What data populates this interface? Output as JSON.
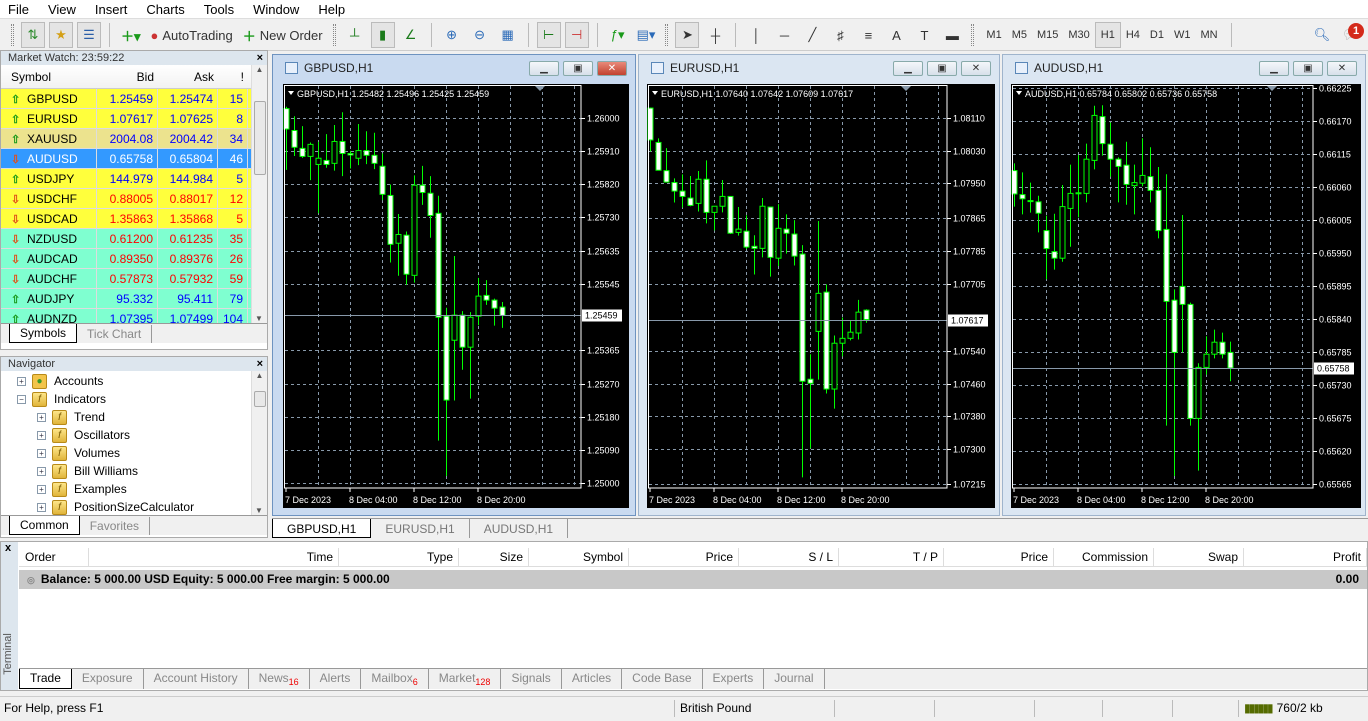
{
  "menu": [
    "File",
    "View",
    "Insert",
    "Charts",
    "Tools",
    "Window",
    "Help"
  ],
  "toolbar": {
    "autotrading": "AutoTrading",
    "new_order": "New Order",
    "timeframes": [
      "M1",
      "M5",
      "M15",
      "M30",
      "H1",
      "H4",
      "D1",
      "W1",
      "MN"
    ],
    "active_timeframe": "H1",
    "notification_count": "1"
  },
  "market_watch": {
    "title": "Market Watch: 23:59:22",
    "columns": [
      "Symbol",
      "Bid",
      "Ask",
      "!"
    ],
    "rows": [
      {
        "symbol": "GBPUSD",
        "bid": "1.25459",
        "ask": "1.25474",
        "spread": "15",
        "dir": "up",
        "bg": "#ffff3c"
      },
      {
        "symbol": "EURUSD",
        "bid": "1.07617",
        "ask": "1.07625",
        "spread": "8",
        "dir": "up",
        "bg": "#ffff3c"
      },
      {
        "symbol": "XAUUSD",
        "bid": "2004.08",
        "ask": "2004.42",
        "spread": "34",
        "dir": "up",
        "bg": "#ece38e"
      },
      {
        "symbol": "AUDUSD",
        "bid": "0.65758",
        "ask": "0.65804",
        "spread": "46",
        "dir": "down",
        "bg": "#3399ff",
        "selected": true
      },
      {
        "symbol": "USDJPY",
        "bid": "144.979",
        "ask": "144.984",
        "spread": "5",
        "dir": "up",
        "bg": "#ffff3c"
      },
      {
        "symbol": "USDCHF",
        "bid": "0.88005",
        "ask": "0.88017",
        "spread": "12",
        "dir": "down",
        "bg": "#ffff3c"
      },
      {
        "symbol": "USDCAD",
        "bid": "1.35863",
        "ask": "1.35868",
        "spread": "5",
        "dir": "down",
        "bg": "#ffff3c"
      },
      {
        "symbol": "NZDUSD",
        "bid": "0.61200",
        "ask": "0.61235",
        "spread": "35",
        "dir": "down",
        "bg": "#7fffd0"
      },
      {
        "symbol": "AUDCAD",
        "bid": "0.89350",
        "ask": "0.89376",
        "spread": "26",
        "dir": "down",
        "bg": "#7fffd0"
      },
      {
        "symbol": "AUDCHF",
        "bid": "0.57873",
        "ask": "0.57932",
        "spread": "59",
        "dir": "down",
        "bg": "#7fffd0"
      },
      {
        "symbol": "AUDJPY",
        "bid": "95.332",
        "ask": "95.411",
        "spread": "79",
        "dir": "up",
        "bg": "#7fffd0"
      },
      {
        "symbol": "AUDNZD",
        "bid": "1.07395",
        "ask": "1.07499",
        "spread": "104",
        "dir": "up",
        "bg": "#7fffd0"
      }
    ],
    "tabs": [
      "Symbols",
      "Tick Chart"
    ]
  },
  "navigator": {
    "title": "Navigator",
    "items": [
      {
        "label": "Accounts",
        "level": 0,
        "sign": "+",
        "icon": "accounts"
      },
      {
        "label": "Indicators",
        "level": 0,
        "sign": "−",
        "icon": "indicator"
      },
      {
        "label": "Trend",
        "level": 1,
        "sign": "+",
        "icon": "indicator"
      },
      {
        "label": "Oscillators",
        "level": 1,
        "sign": "+",
        "icon": "indicator"
      },
      {
        "label": "Volumes",
        "level": 1,
        "sign": "+",
        "icon": "indicator"
      },
      {
        "label": "Bill Williams",
        "level": 1,
        "sign": "+",
        "icon": "indicator"
      },
      {
        "label": "Examples",
        "level": 1,
        "sign": "+",
        "icon": "custom-indicator"
      },
      {
        "label": "PositionSizeCalculator",
        "level": 1,
        "sign": "+",
        "icon": "custom-indicator"
      }
    ],
    "tabs": [
      "Common",
      "Favorites"
    ]
  },
  "colors": {
    "bull_outline": "#00ff00",
    "bear_body": "#ffffff",
    "chart_bg": "#000000",
    "grid": "#8899aa",
    "up_text": "#0000ff",
    "down_text": "#ff0000"
  },
  "chart_data": [
    {
      "type": "candlestick",
      "title": "GBPUSD,H1",
      "info": "GBPUSD,H1  1.25482 1.25496 1.25425 1.25459",
      "ylim": [
        1.24986,
        1.26088
      ],
      "current": "1.25459",
      "yticks": [
        "1.26000",
        "1.25910",
        "1.25820",
        "1.25730",
        "1.25635",
        "1.25545",
        "1.25365",
        "1.25270",
        "1.25180",
        "1.25090",
        "1.25000"
      ],
      "xticks": [
        {
          "index": 0,
          "label": "7 Dec 2023"
        },
        {
          "index": 8,
          "label": "8 Dec 04:00"
        },
        {
          "index": 16,
          "label": "8 Dec 12:00"
        },
        {
          "index": 24,
          "label": "8 Dec 20:00"
        }
      ],
      "ohlc": [
        [
          1.26026,
          1.26031,
          1.25858,
          1.2597
        ],
        [
          1.25966,
          1.26005,
          1.25896,
          1.2592
        ],
        [
          1.25917,
          1.25978,
          1.25891,
          1.25895
        ],
        [
          1.25895,
          1.25933,
          1.2583,
          1.25928
        ],
        [
          1.25873,
          1.25935,
          1.25739,
          1.2589
        ],
        [
          1.25884,
          1.25956,
          1.25864,
          1.25873
        ],
        [
          1.25876,
          1.25981,
          1.25856,
          1.25936
        ],
        [
          1.25936,
          1.26016,
          1.25841,
          1.25903
        ],
        [
          1.25903,
          1.2591,
          1.25862,
          1.25899
        ],
        [
          1.2589,
          1.25984,
          1.25871,
          1.25911
        ],
        [
          1.25911,
          1.25964,
          1.25874,
          1.25898
        ],
        [
          1.25898,
          1.2596,
          1.2586,
          1.25876
        ],
        [
          1.25868,
          1.25903,
          1.25775,
          1.25791
        ],
        [
          1.25788,
          1.25818,
          1.25604,
          1.25654
        ],
        [
          1.25657,
          1.25737,
          1.25568,
          1.25681
        ],
        [
          1.25679,
          1.25689,
          1.25543,
          1.25572
        ],
        [
          1.25569,
          1.25843,
          1.25549,
          1.25816
        ],
        [
          1.25816,
          1.25869,
          1.25762,
          1.25796
        ],
        [
          1.25794,
          1.25841,
          1.25672,
          1.25733
        ],
        [
          1.25739,
          1.25787,
          1.25116,
          1.25454
        ],
        [
          1.25457,
          1.2548,
          1.25019,
          1.25227
        ],
        [
          1.25391,
          1.25622,
          1.25226,
          1.2546
        ],
        [
          1.2546,
          1.25471,
          1.2531,
          1.25372
        ],
        [
          1.25372,
          1.25468,
          1.25231,
          1.25454
        ],
        [
          1.25457,
          1.25562,
          1.25432,
          1.25512
        ],
        [
          1.25514,
          1.25556,
          1.25488,
          1.25501
        ],
        [
          1.25501,
          1.25505,
          1.25431,
          1.25479
        ],
        [
          1.25482,
          1.25496,
          1.25425,
          1.25459
        ]
      ]
    },
    {
      "type": "candlestick",
      "title": "EURUSD,H1",
      "info": "EURUSD,H1  1.07640 1.07642 1.07609 1.07617",
      "ylim": [
        1.07205,
        1.08188
      ],
      "current": "1.07617",
      "yticks": [
        "1.08110",
        "1.08030",
        "1.07950",
        "1.07865",
        "1.07785",
        "1.07705",
        "1.07540",
        "1.07460",
        "1.07380",
        "1.07300",
        "1.07215"
      ],
      "xticks": [
        {
          "index": 0,
          "label": "7 Dec 2023"
        },
        {
          "index": 8,
          "label": "8 Dec 04:00"
        },
        {
          "index": 16,
          "label": "8 Dec 12:00"
        },
        {
          "index": 24,
          "label": "8 Dec 20:00"
        }
      ],
      "ohlc": [
        [
          1.08134,
          1.08135,
          1.08028,
          1.08056
        ],
        [
          1.0805,
          1.0806,
          1.07982,
          1.07982
        ],
        [
          1.07981,
          1.08036,
          1.07953,
          1.07953
        ],
        [
          1.07952,
          1.07962,
          1.07903,
          1.07931
        ],
        [
          1.07931,
          1.07972,
          1.07891,
          1.07918
        ],
        [
          1.07914,
          1.07968,
          1.07894,
          1.07896
        ],
        [
          1.07901,
          1.0798,
          1.07881,
          1.0796
        ],
        [
          1.0796,
          1.08006,
          1.07852,
          1.07879
        ],
        [
          1.07879,
          1.07894,
          1.07835,
          1.07894
        ],
        [
          1.07894,
          1.07958,
          1.07879,
          1.07918
        ],
        [
          1.07918,
          1.07918,
          1.07826,
          1.07828
        ],
        [
          1.0783,
          1.07892,
          1.07822,
          1.07838
        ],
        [
          1.07833,
          1.07872,
          1.07789,
          1.07794
        ],
        [
          1.07796,
          1.07823,
          1.07727,
          1.07791
        ],
        [
          1.07791,
          1.07914,
          1.07769,
          1.07894
        ],
        [
          1.07892,
          1.07892,
          1.07722,
          1.07769
        ],
        [
          1.07767,
          1.07899,
          1.07748,
          1.0784
        ],
        [
          1.07838,
          1.07874,
          1.07778,
          1.07828
        ],
        [
          1.07826,
          1.0786,
          1.07749,
          1.07772
        ],
        [
          1.07777,
          1.07799,
          1.07231,
          1.07466
        ],
        [
          1.07471,
          1.07532,
          1.07302,
          1.07461
        ],
        [
          1.07588,
          1.07858,
          1.0747,
          1.07681
        ],
        [
          1.07684,
          1.07703,
          1.07436,
          1.07447
        ],
        [
          1.07447,
          1.07578,
          1.07399,
          1.07559
        ],
        [
          1.07559,
          1.07622,
          1.07527,
          1.07571
        ],
        [
          1.07571,
          1.07614,
          1.07566,
          1.07586
        ],
        [
          1.07584,
          1.07665,
          1.07568,
          1.07635
        ],
        [
          1.0764,
          1.07642,
          1.07609,
          1.07617
        ]
      ]
    },
    {
      "type": "candlestick",
      "title": "AUDUSD,H1",
      "info": "AUDUSD,H1  0.65784 0.65802 0.65736 0.65758",
      "ylim": [
        0.65558,
        0.66228
      ],
      "current": "0.65758",
      "yticks": [
        "0.66225",
        "0.66170",
        "0.66115",
        "0.66060",
        "0.66005",
        "0.65950",
        "0.65895",
        "0.65840",
        "0.65785",
        "0.65730",
        "0.65675",
        "0.65620",
        "0.65565"
      ],
      "xticks": [
        {
          "index": 0,
          "label": "7 Dec 2023"
        },
        {
          "index": 8,
          "label": "8 Dec 04:00"
        },
        {
          "index": 16,
          "label": "8 Dec 12:00"
        },
        {
          "index": 24,
          "label": "8 Dec 20:00"
        }
      ],
      "ohlc": [
        [
          0.66087,
          0.66099,
          0.66027,
          0.66048
        ],
        [
          0.66047,
          0.66084,
          0.66014,
          0.6604
        ],
        [
          0.66037,
          0.66067,
          0.66017,
          0.66037
        ],
        [
          0.66035,
          0.66045,
          0.65984,
          0.66016
        ],
        [
          0.65987,
          0.66012,
          0.65906,
          0.65957
        ],
        [
          0.65952,
          0.66015,
          0.65922,
          0.65941
        ],
        [
          0.65941,
          0.66063,
          0.65935,
          0.66027
        ],
        [
          0.66024,
          0.66097,
          0.6596,
          0.66049
        ],
        [
          0.66049,
          0.66113,
          0.66009,
          0.6605
        ],
        [
          0.66049,
          0.66132,
          0.66034,
          0.66106
        ],
        [
          0.66104,
          0.66195,
          0.66089,
          0.66179
        ],
        [
          0.66177,
          0.66196,
          0.66112,
          0.66132
        ],
        [
          0.66131,
          0.66167,
          0.66077,
          0.66106
        ],
        [
          0.66106,
          0.66109,
          0.66034,
          0.66094
        ],
        [
          0.66096,
          0.66135,
          0.6603,
          0.66064
        ],
        [
          0.66062,
          0.66097,
          0.66014,
          0.66067
        ],
        [
          0.66066,
          0.66141,
          0.66061,
          0.66079
        ],
        [
          0.66077,
          0.66126,
          0.66034,
          0.66054
        ],
        [
          0.66054,
          0.66093,
          0.65974,
          0.65987
        ],
        [
          0.65989,
          0.66081,
          0.65662,
          0.65869
        ],
        [
          0.65871,
          0.65889,
          0.65578,
          0.65784
        ],
        [
          0.65894,
          0.66013,
          0.65784,
          0.65864
        ],
        [
          0.65864,
          0.65867,
          0.65662,
          0.65674
        ],
        [
          0.65674,
          0.65766,
          0.65587,
          0.65759
        ],
        [
          0.65759,
          0.65811,
          0.65747,
          0.65781
        ],
        [
          0.65781,
          0.65822,
          0.65774,
          0.65801
        ],
        [
          0.65801,
          0.65817,
          0.65774,
          0.65781
        ],
        [
          0.65784,
          0.65802,
          0.65736,
          0.65758
        ]
      ]
    }
  ],
  "chart_tabs": [
    "GBPUSD,H1",
    "EURUSD,H1",
    "AUDUSD,H1"
  ],
  "terminal": {
    "side_label": "Terminal",
    "columns": [
      "Order",
      "Time",
      "Type",
      "Size",
      "Symbol",
      "Price",
      "S / L",
      "T / P",
      "Price",
      "Commission",
      "Swap",
      "Profit"
    ],
    "balance_text": "Balance: 5 000.00 USD  Equity: 5 000.00  Free margin: 5 000.00",
    "profit": "0.00",
    "tabs": [
      {
        "label": "Trade"
      },
      {
        "label": "Exposure"
      },
      {
        "label": "Account History"
      },
      {
        "label": "News",
        "badge": "16"
      },
      {
        "label": "Alerts"
      },
      {
        "label": "Mailbox",
        "badge": "6"
      },
      {
        "label": "Market",
        "badge": "128"
      },
      {
        "label": "Signals"
      },
      {
        "label": "Articles"
      },
      {
        "label": "Code Base"
      },
      {
        "label": "Experts"
      },
      {
        "label": "Journal"
      }
    ]
  },
  "status": {
    "help": "For Help, press F1",
    "profile": "British Pound",
    "traffic": "760/2 kb"
  }
}
